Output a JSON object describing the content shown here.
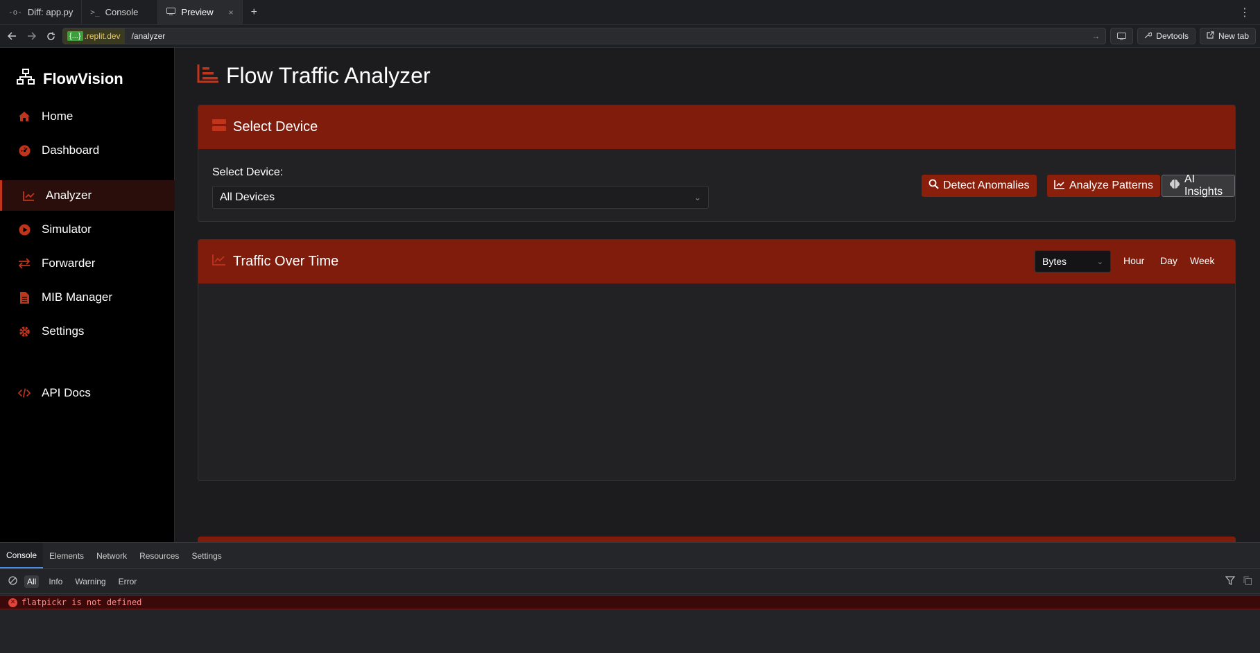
{
  "browser": {
    "tabs": [
      {
        "icon": "-o-",
        "label": "Diff: app.py"
      },
      {
        "icon": ">_",
        "label": "Console"
      },
      {
        "icon": "preview",
        "label": "Preview",
        "close": "×"
      }
    ],
    "add_tab": "+",
    "menu": "⋮",
    "url_badge": "{...}",
    "url_host": ".replit.dev",
    "url_path": "/analyzer",
    "devtools_label": "Devtools",
    "newtab_label": "New tab"
  },
  "sidebar": {
    "brand": "FlowVision",
    "items": [
      {
        "label": "Home",
        "icon": "home-icon"
      },
      {
        "label": "Dashboard",
        "icon": "dashboard-icon"
      },
      {
        "label": "Analyzer",
        "icon": "chart-line-icon",
        "active": true
      },
      {
        "label": "Simulator",
        "icon": "play-icon"
      },
      {
        "label": "Forwarder",
        "icon": "exchange-icon"
      },
      {
        "label": "MIB Manager",
        "icon": "file-icon"
      },
      {
        "label": "Settings",
        "icon": "gear-icon"
      },
      {
        "label": "API Docs",
        "icon": "code-icon"
      }
    ]
  },
  "main": {
    "title": "Flow Traffic Analyzer",
    "device_card": {
      "header": "Select Device",
      "field_label": "Select Device:",
      "selected": "All Devices",
      "buttons": {
        "detect": "Detect Anomalies",
        "analyze": "Analyze Patterns",
        "insights": "AI Insights"
      }
    },
    "traffic_card": {
      "header": "Traffic Over Time",
      "metric": "Bytes",
      "ranges": [
        "Hour",
        "Day",
        "Week"
      ]
    }
  },
  "devtools": {
    "tabs": [
      "Console",
      "Elements",
      "Network",
      "Resources",
      "Settings"
    ],
    "filters": [
      "All",
      "Info",
      "Warning",
      "Error"
    ],
    "error_message": "flatpickr is not defined"
  },
  "colors": {
    "accent": "#c0341c",
    "card_header": "#7f1c0b",
    "button_red": "#8a1f0c"
  }
}
